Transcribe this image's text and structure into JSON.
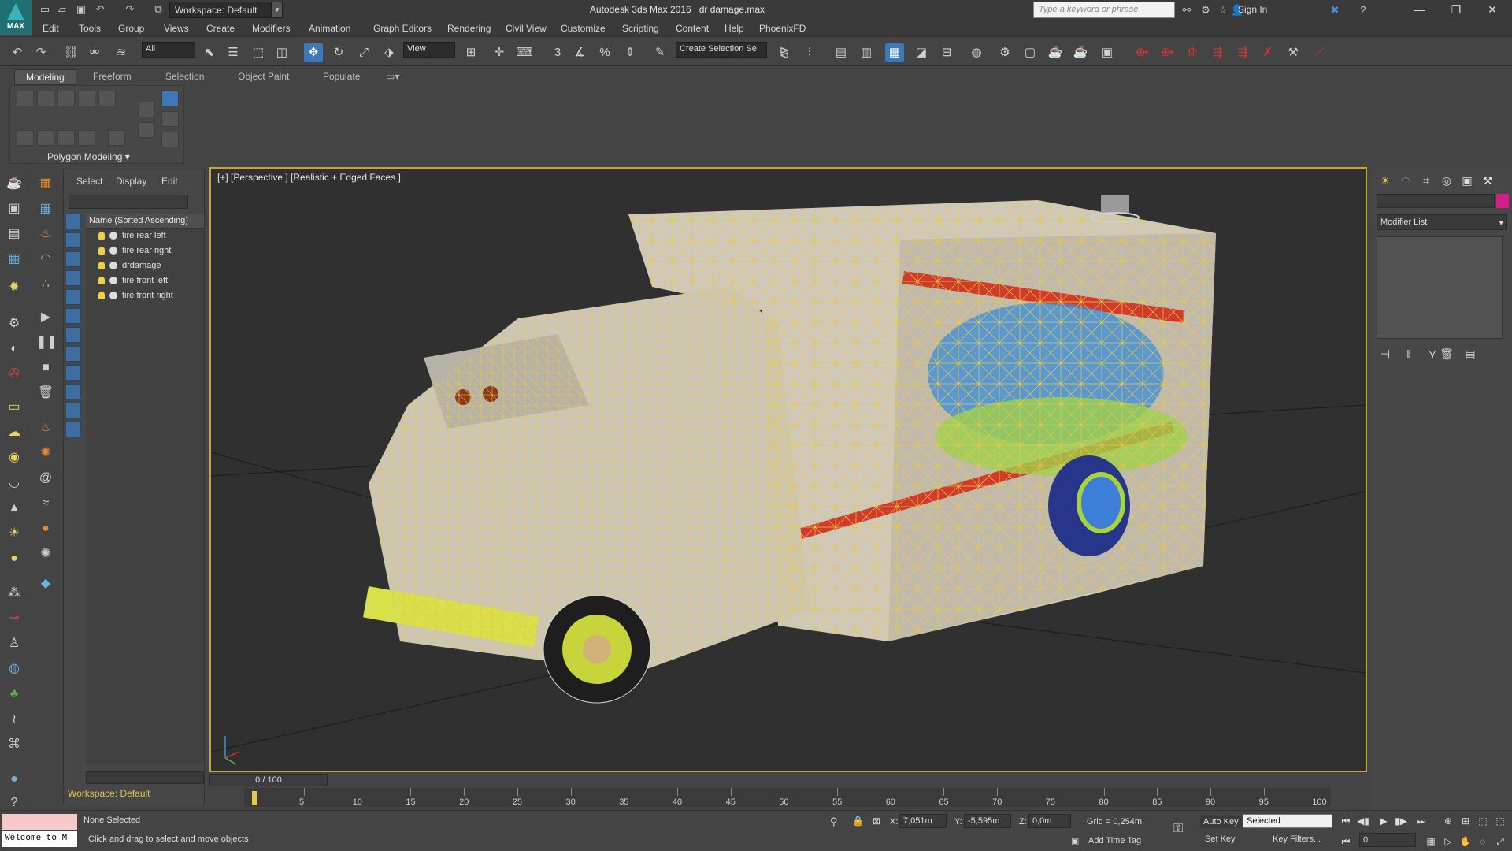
{
  "titlebar": {
    "app_logo": "MAX",
    "workspace": "Workspace: Default",
    "app_name": "Autodesk 3ds Max 2016",
    "file_name": "dr damage.max",
    "search_placeholder": "Type a keyword or phrase",
    "sign_in": "Sign In"
  },
  "menu": [
    "Edit",
    "Tools",
    "Group",
    "Views",
    "Create",
    "Modifiers",
    "Animation",
    "Graph Editors",
    "Rendering",
    "Civil View",
    "Customize",
    "Scripting",
    "Content",
    "Help",
    "PhoenixFD"
  ],
  "toolbar": {
    "selection_filter": "All",
    "ref_coord": "View",
    "snap_label": "3",
    "selection_set_placeholder": "Create Selection Se"
  },
  "ribbon": {
    "tabs": [
      "Modeling",
      "Freeform",
      "Selection",
      "Object Paint",
      "Populate"
    ],
    "active_tab": "Modeling",
    "panel_label": "Polygon Modeling"
  },
  "explorer": {
    "tabs": [
      "Select",
      "Display",
      "Edit"
    ],
    "column_header": "Name (Sorted Ascending)",
    "items": [
      "tire rear left",
      "tire rear right",
      "drdamage",
      "tire front left",
      "tire front right"
    ]
  },
  "viewport": {
    "label": "[+] [Perspective ] [Realistic + Edged Faces ]"
  },
  "command_panel": {
    "modifier_list": "Modifier List",
    "object_color": "#d21e8a"
  },
  "timeline": {
    "slider": "0 / 100",
    "ticks": [
      "5",
      "10",
      "15",
      "20",
      "25",
      "30",
      "35",
      "40",
      "45",
      "50",
      "55",
      "60",
      "65",
      "70",
      "75",
      "80",
      "85",
      "90",
      "95",
      "100"
    ]
  },
  "status": {
    "listener": "Welcome to M",
    "selection": "None Selected",
    "prompt": "Click and drag to select and move objects",
    "x_label": "X:",
    "x": "7,051m",
    "y_label": "Y:",
    "y": "-5,595m",
    "z_label": "Z:",
    "z": "0,0m",
    "grid": "Grid = 0,254m",
    "add_time_tag": "Add Time Tag",
    "auto_key": "Auto Key",
    "set_key": "Set Key",
    "selected_dd": "Selected",
    "key_filters": "Key Filters...",
    "frame": "0"
  },
  "workspace_label": "Workspace: Default",
  "colors": {
    "viewport_border": "#c9a23a",
    "wireframe": "#e8c84a",
    "active_tool": "#3b79b8"
  }
}
